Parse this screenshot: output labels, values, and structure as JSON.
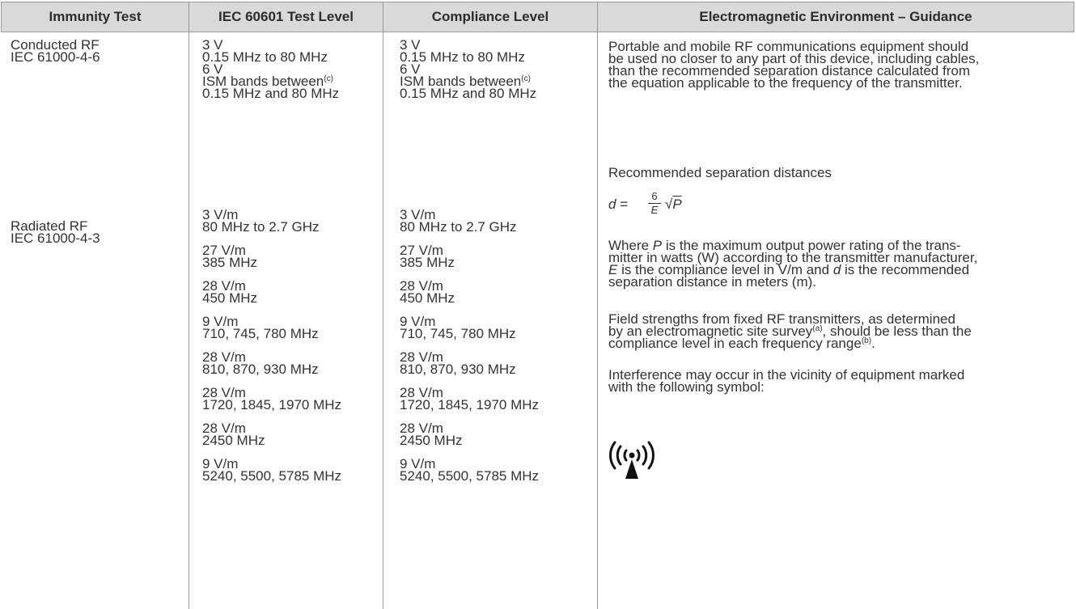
{
  "headers": {
    "immunity_test": "Immunity Test",
    "iec_test_level": "IEC 60601 Test Level",
    "compliance_level": "Compliance Level",
    "guidance": "Electromagnetic Environment – Guidance"
  },
  "immunity_tests": {
    "conducted_name": "Conducted RF",
    "conducted_std": "IEC 61000-4-6",
    "radiated_name": "Radiated RF",
    "radiated_std": "IEC 61000-4-3"
  },
  "conducted_levels": {
    "l1": "3 V",
    "l2": "0.15 MHz to 80 MHz",
    "l3": "6 V",
    "l4": "ISM bands between",
    "l4_sup": "(c)",
    "l5": "0.15 MHz and 80 MHz"
  },
  "radiated_levels": [
    {
      "level": "3 V/m",
      "freq": "80 MHz to 2.7 GHz"
    },
    {
      "level": "27 V/m",
      "freq": "385 MHz"
    },
    {
      "level": "28 V/m",
      "freq": "450 MHz"
    },
    {
      "level": "9 V/m",
      "freq": "710, 745, 780 MHz"
    },
    {
      "level": "28 V/m",
      "freq": "810, 870, 930 MHz"
    },
    {
      "level": "28 V/m",
      "freq": "1720, 1845, 1970 MHz"
    },
    {
      "level": "28 V/m",
      "freq": "2450 MHz"
    },
    {
      "level": "9 V/m",
      "freq": "5240, 5500, 5785 MHz"
    }
  ],
  "guidance": {
    "para1_lines": [
      "Portable and mobile RF communications equipment should",
      "be used no closer to any part of this device, including cables,",
      "than the recommended separation distance calculated from",
      "the equation applicable to the frequency of the transmitter."
    ],
    "recommended": "Recommended separation distances",
    "formula": {
      "d": "d",
      "eq": "=",
      "num": "6",
      "den": "E",
      "root": "√",
      "p": "P"
    },
    "where": {
      "w1": "Where ",
      "p": "P",
      "w2": " is the maximum output power rating of the trans-",
      "l2": "mitter in watts (W) according to the transmitter manufacturer,",
      "e": "E",
      "l3": " is the compliance level in V/m and ",
      "d": "d",
      "l3b": " is the recommended",
      "l4": "separation distance in meters (m)."
    },
    "field": {
      "l1": "Field strengths from fixed RF transmitters, as determined",
      "l2": "by an electromagnetic site survey",
      "sup_a": "(a)",
      "l2b": ", should be less than the",
      "l3": "compliance level in each frequency range",
      "sup_b": "(b)",
      "l3b": "."
    },
    "interference_lines": [
      "Interference may occur in the vicinity of equipment marked",
      "with the following symbol:"
    ]
  },
  "colors": {
    "header_bg": "#d9d9d9",
    "rule": "#9a9a9a",
    "text": "#333333"
  },
  "icons": {
    "symbol": "non-ionizing-radiation-icon"
  }
}
